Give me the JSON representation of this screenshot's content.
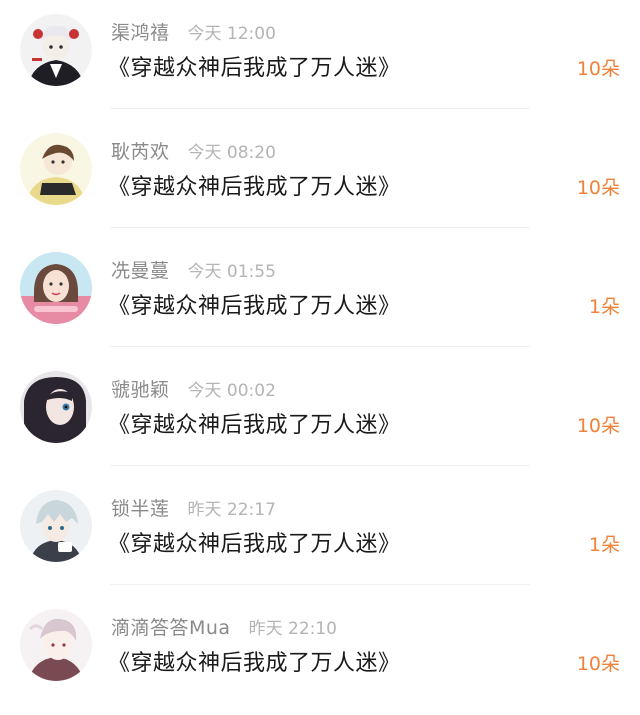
{
  "colors": {
    "username": "#8a8a8a",
    "time": "#b4b4b4",
    "book_title": "#1a1a1a",
    "count": "#f0823a",
    "divider": "#f0f0f0"
  },
  "records": [
    {
      "user": "渠鸿禧",
      "time": "今天 12:00",
      "book": "《穿越众神后我成了万人迷》",
      "count": "10朵",
      "avatar_icon": "dark-suit-anime-avatar"
    },
    {
      "user": "耿芮欢",
      "time": "今天 08:20",
      "book": "《穿越众神后我成了万人迷》",
      "count": "10朵",
      "avatar_icon": "yellow-hoodie-avatar"
    },
    {
      "user": "冼曼蔓",
      "time": "今天 01:55",
      "book": "《穿越众神后我成了万人迷》",
      "count": "1朵",
      "avatar_icon": "girl-portrait-avatar"
    },
    {
      "user": "虢驰颖",
      "time": "今天 00:02",
      "book": "《穿越众神后我成了万人迷》",
      "count": "10朵",
      "avatar_icon": "dark-hair-anime-avatar"
    },
    {
      "user": "锁半莲",
      "time": "昨天 22:17",
      "book": "《穿越众神后我成了万人迷》",
      "count": "1朵",
      "avatar_icon": "silver-hair-anime-avatar"
    },
    {
      "user": "滴滴答答Mua",
      "time": "昨天 22:10",
      "book": "《穿越众神后我成了万人迷》",
      "count": "10朵",
      "avatar_icon": "pale-anime-avatar"
    }
  ]
}
